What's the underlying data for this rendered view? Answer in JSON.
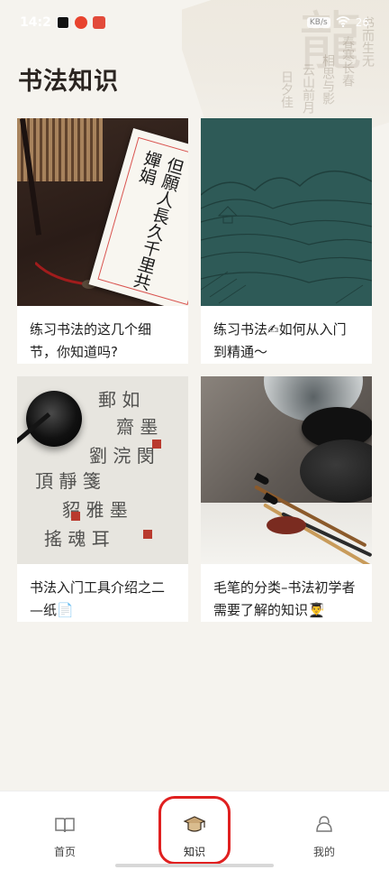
{
  "status_bar": {
    "time": "14:2",
    "chip_text": "KB/s",
    "battery": "26"
  },
  "page": {
    "title": "书法知识"
  },
  "cards": [
    {
      "title": "练习书法的这几个细节，你知道吗?",
      "image": "calligraphy-paper-image",
      "image_text": "但願人長久千里共嬋娟"
    },
    {
      "title": "练习书法✍如何从入门到精通～",
      "image": "landscape-illustration-image"
    },
    {
      "title": "书法入门工具介绍之二—纸📄",
      "image": "calligraphy-cloth-image"
    },
    {
      "title": "毛笔的分类–书法初学者需要了解的知识👨‍🎓",
      "image": "brushes-inkstone-image"
    }
  ],
  "bottom_nav": {
    "items": [
      {
        "label": "首页",
        "icon": "book-icon",
        "active": false
      },
      {
        "label": "知识",
        "icon": "graduation-cap-icon",
        "active": true
      },
      {
        "label": "我的",
        "icon": "profile-icon",
        "active": false
      }
    ]
  },
  "colors": {
    "background": "#f5f3ee",
    "highlight": "#e02020",
    "teal": "#2e5a57"
  }
}
